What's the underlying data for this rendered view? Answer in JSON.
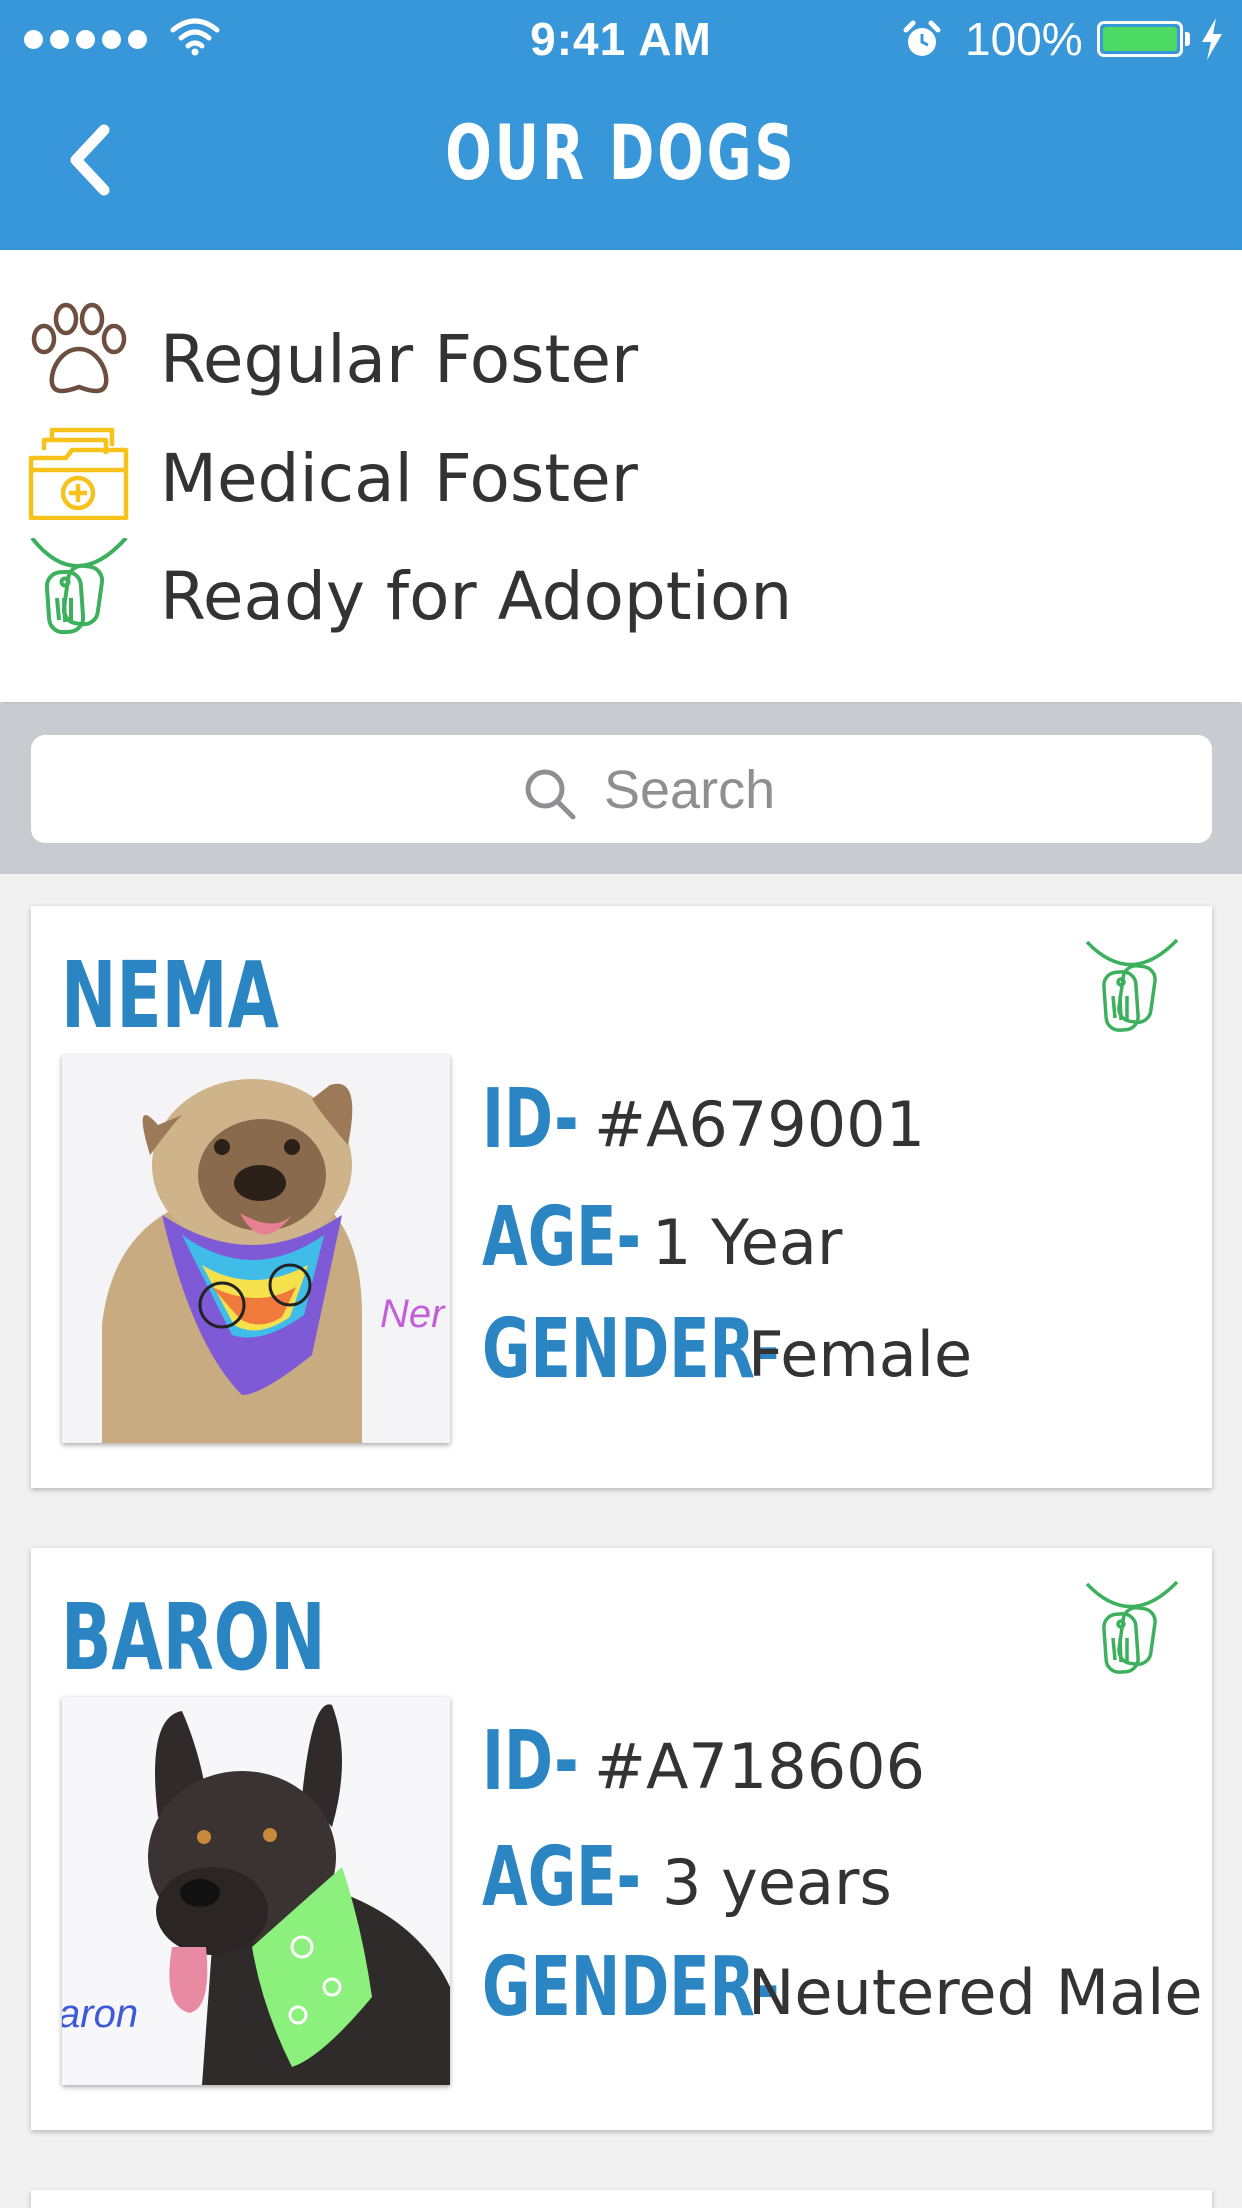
{
  "status_bar": {
    "time": "9:41 AM",
    "battery": "100%"
  },
  "nav": {
    "title": "OUR DOGS",
    "back_icon": "chevron-left-icon"
  },
  "legend": [
    {
      "icon": "paw-icon",
      "label": "Regular Foster",
      "color": "#6e4e3f"
    },
    {
      "icon": "medical-folder-icon",
      "label": "Medical Foster",
      "color": "#f6c21b"
    },
    {
      "icon": "dog-tag-icon",
      "label": "Ready for Adoption",
      "color": "#3cb05c"
    }
  ],
  "search": {
    "placeholder": "Search"
  },
  "dogs": [
    {
      "name": "NEMA",
      "status_icon": "dog-tag-icon",
      "id_label": "ID-",
      "id": "#A679001",
      "age_label": "AGE-",
      "age": "1 Year",
      "gender_label": "GENDER-",
      "gender": "Female",
      "photo_caption": "Ner"
    },
    {
      "name": "BARON",
      "status_icon": "dog-tag-icon",
      "id_label": "ID-",
      "id": "#A718606",
      "age_label": "AGE-",
      "age": "3 years",
      "gender_label": "GENDER-",
      "gender": "Neutered Male",
      "photo_caption": "aron"
    }
  ],
  "colors": {
    "header": "#3897d8",
    "accent": "#2b85c2",
    "adoption_green": "#3cb05c"
  }
}
